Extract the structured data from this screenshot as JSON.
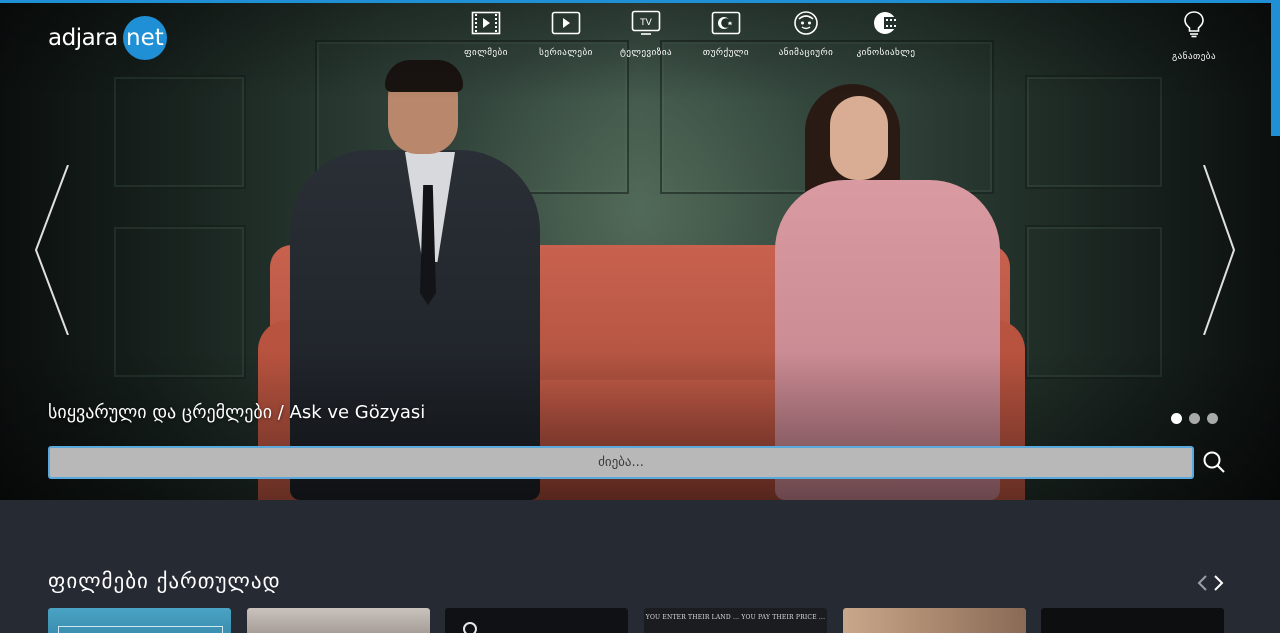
{
  "brand": {
    "name_part1": "adjara",
    "name_part2": "net"
  },
  "nav": {
    "items": [
      {
        "label": "ფილმები",
        "icon": "film-icon"
      },
      {
        "label": "სერიალები",
        "icon": "play-icon"
      },
      {
        "label": "ტელევიზია",
        "icon": "tv-icon"
      },
      {
        "label": "თურქული",
        "icon": "turkish-flag-icon"
      },
      {
        "label": "ანიმაციური",
        "icon": "cartoon-face-icon"
      },
      {
        "label": "კინოსიახლე",
        "icon": "film-reel-icon"
      }
    ],
    "tips": {
      "label": "განათება",
      "icon": "lightbulb-icon"
    }
  },
  "hero": {
    "title": "სიყვარული და ცრემლები / Ask ve Gözyasi",
    "slide_count": 3,
    "active_slide": 1
  },
  "search": {
    "placeholder": "ძიება..."
  },
  "section": {
    "title": "ფილმები ქართულად",
    "thumbnails": [
      {
        "caption": ""
      },
      {
        "caption": ""
      },
      {
        "caption": ""
      },
      {
        "caption": "YOU ENTER THEIR LAND ... YOU PAY THEIR PRICE ..."
      },
      {
        "caption": ""
      },
      {
        "caption": ""
      }
    ]
  },
  "colors": {
    "accent": "#1f8fd6",
    "background": "#262a33"
  }
}
